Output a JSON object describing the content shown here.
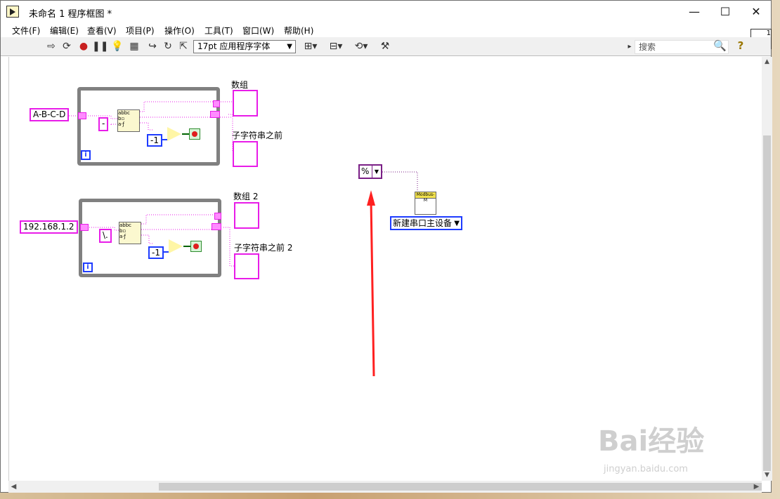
{
  "window": {
    "title": "未命名 1 程序框图 *",
    "minimize": "—",
    "maximize": "☐",
    "close": "✕"
  },
  "menu": [
    "文件(F)",
    "编辑(E)",
    "查看(V)",
    "项目(P)",
    "操作(O)",
    "工具(T)",
    "窗口(W)",
    "帮助(H)"
  ],
  "toolbar": {
    "font_select": "17pt 应用程序字体",
    "search_placeholder": "搜索"
  },
  "diagram": {
    "loop1": {
      "input": "A-B-C-D",
      "sep": "-",
      "minus_one": "-1",
      "iter": "i",
      "array_label": "数组",
      "substring_label": "子字符串之前"
    },
    "loop2": {
      "input": "192.168.1.2",
      "sep": "\\.",
      "minus_one": "-1",
      "iter": "i",
      "array_label": "数组 2",
      "substring_label": "子字符串之前 2"
    },
    "resource_const": "%",
    "modbus_vi": "Modbus-M",
    "enum_const": "新建串口主设备"
  },
  "colors": {
    "string_wire": "#e81ce8",
    "numeric_wire": "#1e3cff",
    "arrow": "#ff2020",
    "loop_border": "#808080"
  }
}
